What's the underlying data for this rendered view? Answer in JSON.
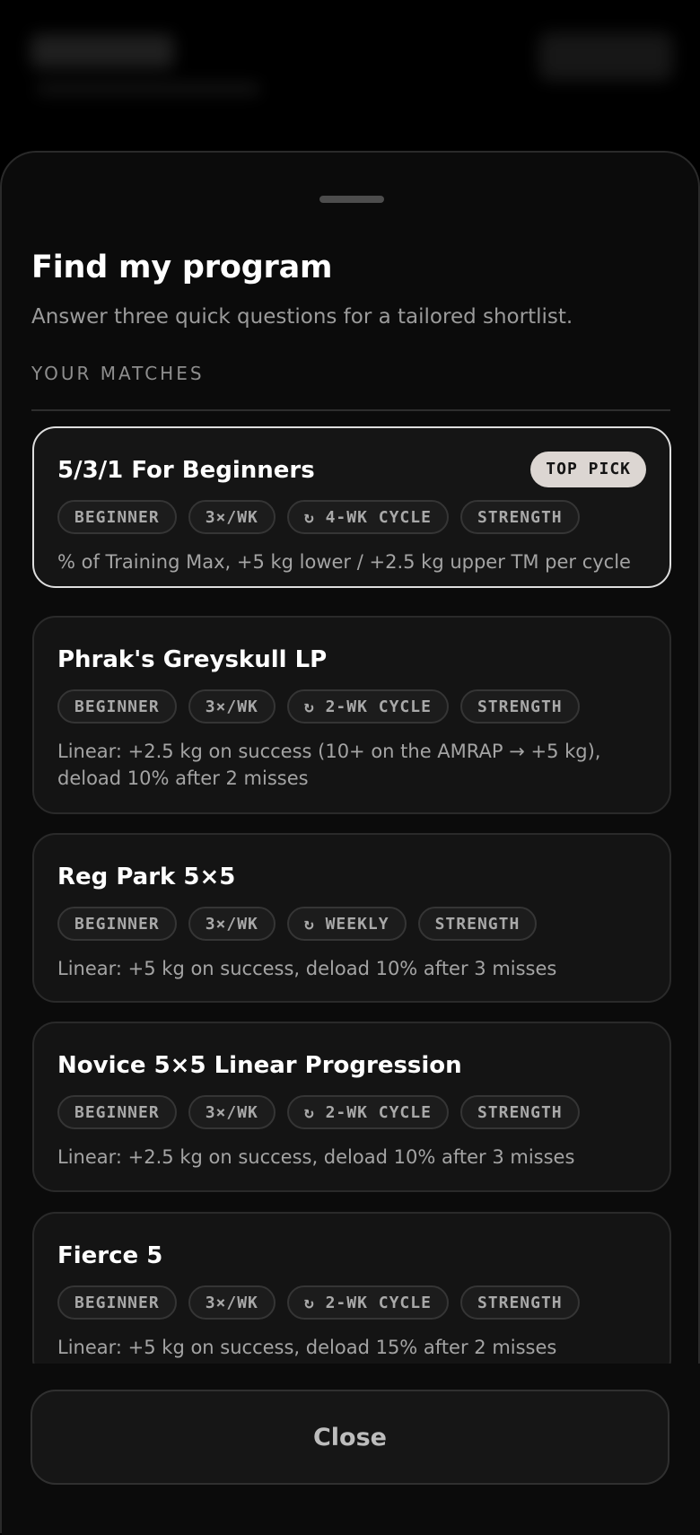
{
  "sheet": {
    "title": "Find my program",
    "subtitle": "Answer three quick questions for a tailored shortlist.",
    "section_label": "YOUR MATCHES",
    "close_label": "Close"
  },
  "programs": [
    {
      "name": "5/3/1 For Beginners",
      "badge": "TOP PICK",
      "tags": [
        "BEGINNER",
        "3×/WK",
        "↻ 4-WK CYCLE",
        "STRENGTH"
      ],
      "description": "% of Training Max, +5 kg lower / +2.5 kg upper TM per cycle"
    },
    {
      "name": "Phrak's Greyskull LP",
      "tags": [
        "BEGINNER",
        "3×/WK",
        "↻ 2-WK CYCLE",
        "STRENGTH"
      ],
      "description": "Linear: +2.5 kg on success (10+ on the AMRAP → +5 kg), deload 10% after 2 misses"
    },
    {
      "name": "Reg Park 5×5",
      "tags": [
        "BEGINNER",
        "3×/WK",
        "↻ WEEKLY",
        "STRENGTH"
      ],
      "description": "Linear: +5 kg on success, deload 10% after 3 misses"
    },
    {
      "name": "Novice 5×5 Linear Progression",
      "tags": [
        "BEGINNER",
        "3×/WK",
        "↻ 2-WK CYCLE",
        "STRENGTH"
      ],
      "description": "Linear: +2.5 kg on success, deload 10% after 3 misses"
    },
    {
      "name": "Fierce 5",
      "tags": [
        "BEGINNER",
        "3×/WK",
        "↻ 2-WK CYCLE",
        "STRENGTH"
      ],
      "description": "Linear: +5 kg on success, deload 15% after 2 misses"
    }
  ],
  "colors": {
    "background": "#000000",
    "sheet": "#0b0b0b",
    "card": "#141414",
    "top_pick_border": "#dedede",
    "badge": "#dcd6d2"
  }
}
